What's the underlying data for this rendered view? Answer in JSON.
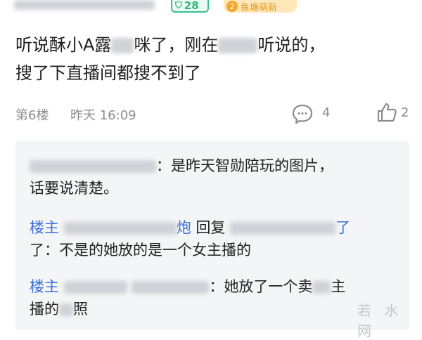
{
  "header": {
    "level_badge": "28",
    "fan_badge_number": "2",
    "fan_badge_label": "鱼塘萌新"
  },
  "post": {
    "text_part1": "听说酥小A露",
    "text_part2": "咪了，刚在",
    "text_part3": "听说的，",
    "text_line2": "搜了下直播间都搜不到了"
  },
  "meta": {
    "floor": "第6楼",
    "time": "昨天 16:09",
    "comment_count": "4",
    "like_count": "2",
    "comment_icon": "comment-bubble-icon",
    "like_icon": "thumbs-up-icon"
  },
  "replies": [
    {
      "text_part1": "：是昨天智勋陪玩的图片，",
      "text_line2": "话要说清楚。"
    },
    {
      "host_label": "楼主",
      "partial_name": "炮",
      "reply_word": "回复",
      "trailing_char": "了",
      "text_line2": "了：不是的她放的是一个女主播的"
    },
    {
      "host_label": "楼主",
      "text_part1": "：她放了一个卖",
      "text_part2": "主",
      "text_line2_a": "播的",
      "text_line2_b": "照"
    }
  ],
  "watermark": "若 水 网",
  "colors": {
    "host_blue": "#3d6fd8",
    "level_green": "#2fb880",
    "fan_orange": "#e39a1e",
    "meta_gray": "#8c8c8c",
    "panel_bg": "#f4f5f6"
  }
}
